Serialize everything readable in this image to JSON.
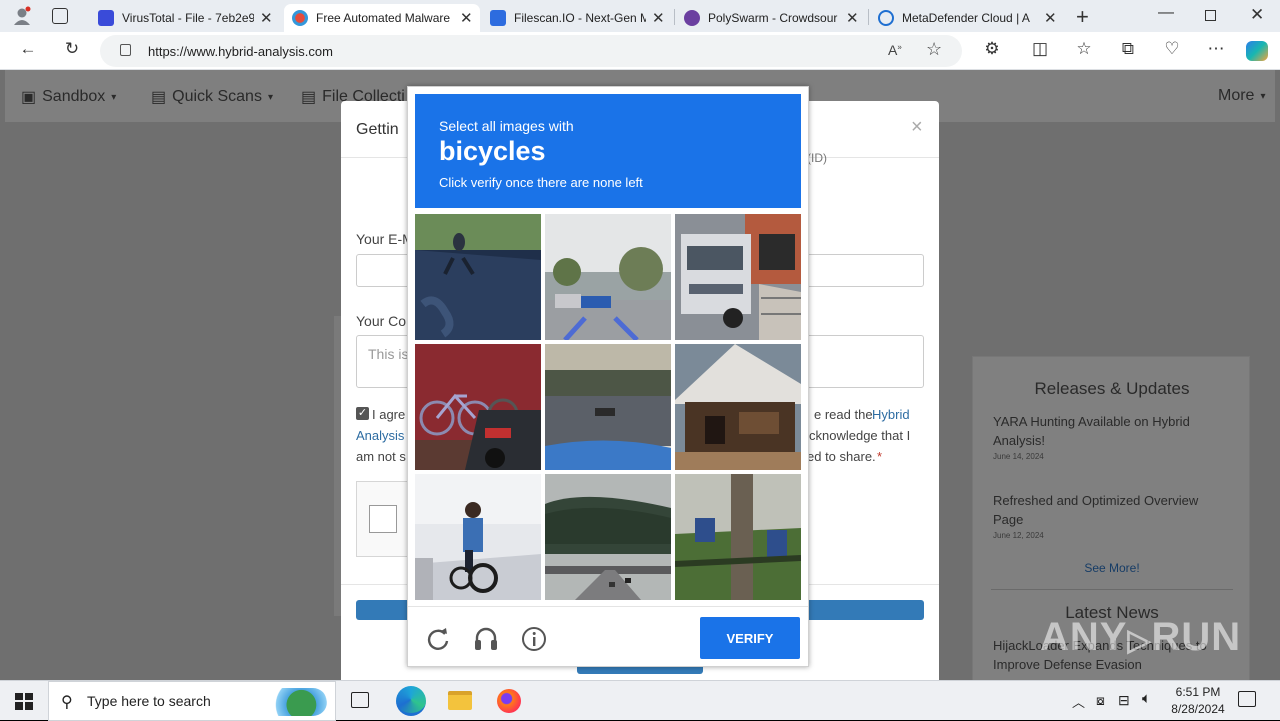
{
  "browser": {
    "tabs": [
      {
        "title": "VirusTotal - File - 7eb2e9",
        "favicon_color": "#3a4bd9"
      },
      {
        "title": "Free Automated Malware",
        "favicon_color": "#c0392b"
      },
      {
        "title": "Filescan.IO - Next-Gen M",
        "favicon_color": "#2d6cdf"
      },
      {
        "title": "PolySwarm - Crowdsour",
        "favicon_color": "#6b3fa0"
      },
      {
        "title": "MetaDefender Cloud | A",
        "favicon_color": "#1f6fd1"
      }
    ],
    "url": "https://www.hybrid-analysis.com"
  },
  "site": {
    "nav": {
      "sandbox": "Sandbox",
      "quick_scans": "Quick Scans",
      "file_collections": "File Collecti",
      "more": "More"
    },
    "sidebar": {
      "releases_heading": "Releases & Updates",
      "items": [
        {
          "title": "YARA Hunting Available on Hybrid Analysis!",
          "date": "June 14, 2024"
        },
        {
          "title": "Refreshed and Optimized Overview Page",
          "date": "June 12, 2024"
        }
      ],
      "see_more": "See More!",
      "news_heading": "Latest News",
      "news_item": "HijackLoader Expands Techniques to Improve Defense Evasion"
    }
  },
  "modal": {
    "title": "Gettin",
    "ip_hint": "(ID)",
    "email_label": "Your E-M",
    "comment_label": "Your Co",
    "comment_placeholder": "This is",
    "agree_left": [
      "I agre",
      "Analysis",
      "am not s"
    ],
    "agree_right": [
      "e read the",
      "cknowledge that I",
      "ed to share."
    ],
    "agree_link": "Hybrid",
    "required": "*"
  },
  "captcha": {
    "prompt": "Select all images with",
    "target": "bicycles",
    "instruction": "Click verify once there are none left",
    "verify_label": "VERIFY",
    "tiles": [
      "tree shadow on road",
      "parking lot",
      "white truck",
      "bicycles and car",
      "plaza with cars",
      "tent shelter",
      "person on bicycle",
      "forest highway",
      "tree and bench"
    ]
  },
  "watermark": "ANY RUN",
  "taskbar": {
    "search_placeholder": "Type here to search",
    "time": "6:51 PM",
    "date": "8/28/2024"
  }
}
